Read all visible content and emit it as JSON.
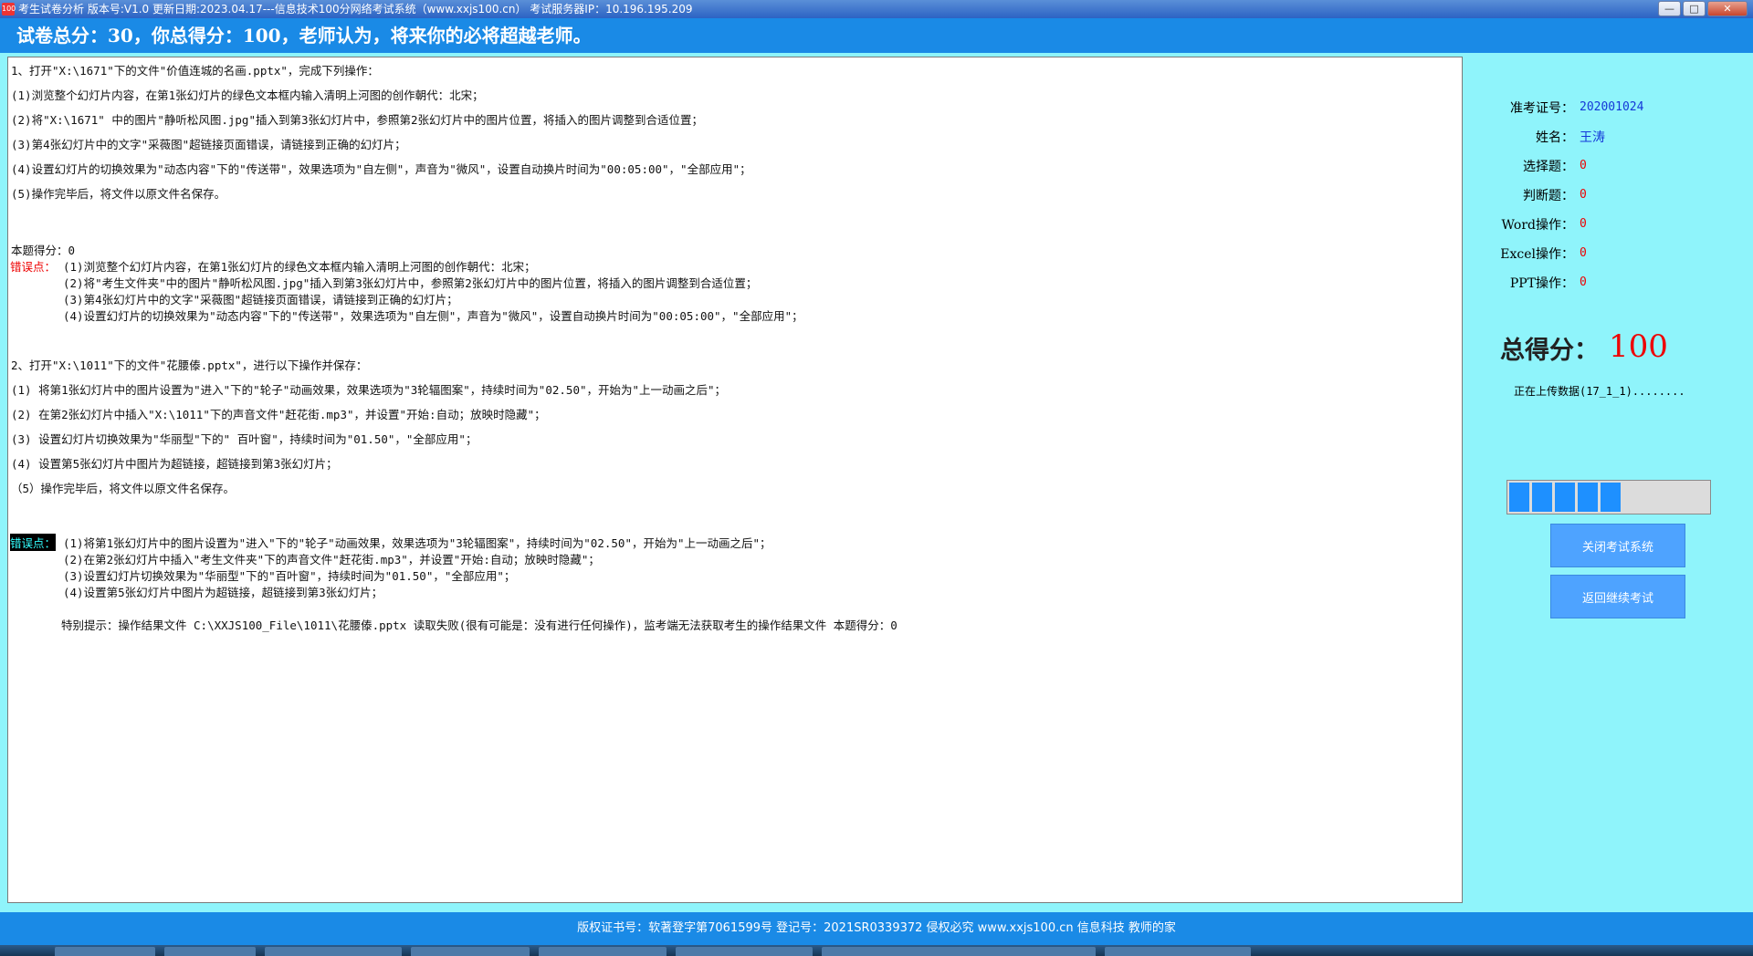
{
  "window": {
    "title": "考生试卷分析 版本号:V1.0 更新日期:2023.04.17---信息技术100分网络考试系统（www.xxjs100.cn）    考试服务器IP：10.196.195.209",
    "icon_text": "100",
    "minimize_label": "—",
    "maximize_label": "□",
    "close_label": "✕"
  },
  "banner": {
    "text": "试卷总分：30，你总得分：100，老师认为，将来你的必将超越老师。"
  },
  "question1": {
    "header": "1、打开\"X:\\1671\"下的文件\"价值连城的名画.pptx\"，完成下列操作：",
    "steps": [
      "(1)浏览整个幻灯片内容，在第1张幻灯片的绿色文本框内输入清明上河图的创作朝代：北宋；",
      "(2)将\"X:\\1671\" 中的图片\"静听松风图.jpg\"插入到第3张幻灯片中，参照第2张幻灯片中的图片位置，将插入的图片调整到合适位置；",
      "(3)第4张幻灯片中的文字\"采薇图\"超链接页面错误，请链接到正确的幻灯片；",
      "(4)设置幻灯片的切换效果为\"动态内容\"下的\"传送带\"，效果选项为\"自左侧\"，声音为\"微风\"，设置自动换片时间为\"00:05:00\"，\"全部应用\"；",
      "(5)操作完毕后，将文件以原文件名保存。"
    ],
    "score_text": "本题得分：0",
    "error_label": "错误点：",
    "errors": [
      "(1)浏览整个幻灯片内容，在第1张幻灯片的绿色文本框内输入清明上河图的创作朝代：北宋；",
      "(2)将\"考生文件夹\"中的图片\"静听松风图.jpg\"插入到第3张幻灯片中，参照第2张幻灯片中的图片位置，将插入的图片调整到合适位置；",
      "(3)第4张幻灯片中的文字\"采薇图\"超链接页面错误，请链接到正确的幻灯片；",
      "(4)设置幻灯片的切换效果为\"动态内容\"下的\"传送带\"，效果选项为\"自左侧\"，声音为\"微风\"，设置自动换片时间为\"00:05:00\"，\"全部应用\"；"
    ]
  },
  "question2": {
    "header": "2、打开\"X:\\1011\"下的文件\"花腰傣.pptx\"，进行以下操作并保存：",
    "steps": [
      "(1) 将第1张幻灯片中的图片设置为\"进入\"下的\"轮子\"动画效果，效果选项为\"3轮辐图案\"，持续时间为\"02.50\"，开始为\"上一动画之后\"；",
      "(2) 在第2张幻灯片中插入\"X:\\1011\"下的声音文件\"赶花街.mp3\"，并设置\"开始:自动；放映时隐藏\"；",
      "(3) 设置幻灯片切换效果为\"华丽型\"下的\" 百叶窗\"，持续时间为\"01.50\"，\"全部应用\"；",
      "(4) 设置第5张幻灯片中图片为超链接，超链接到第3张幻灯片；",
      "（5）操作完毕后，将文件以原文件名保存。"
    ],
    "error_label": "错误点：",
    "errors": [
      "(1)将第1张幻灯片中的图片设置为\"进入\"下的\"轮子\"动画效果，效果选项为\"3轮辐图案\"，持续时间为\"02.50\"，开始为\"上一动画之后\"；",
      "(2)在第2张幻灯片中插入\"考生文件夹\"下的声音文件\"赶花街.mp3\"，并设置\"开始:自动；放映时隐藏\"；",
      "(3)设置幻灯片切换效果为\"华丽型\"下的\"百叶窗\"，持续时间为\"01.50\"，\"全部应用\"；",
      "(4)设置第5张幻灯片中图片为超链接，超链接到第3张幻灯片；"
    ],
    "special_note": "特别提示：操作结果文件 C:\\XXJS100_File\\1011\\花腰傣.pptx 读取失败(很有可能是：没有进行任何操作)，监考端无法获取考生的操作结果文件        本题得分：0"
  },
  "student": {
    "exam_id_label": "准考证号：",
    "exam_id": "202001024",
    "name_label": "姓名：",
    "name": "王涛",
    "choice_label": "选择题：",
    "choice": "0",
    "judge_label": "判断题：",
    "judge": "0",
    "word_label": "Word操作：",
    "word": "0",
    "excel_label": "Excel操作：",
    "excel": "0",
    "ppt_label": "PPT操作：",
    "ppt": "0"
  },
  "total": {
    "label": "总得分：",
    "value": "100"
  },
  "upload_status": "正在上传数据(17_1_1)........",
  "progress": {
    "filled_segments": 5,
    "total_segments": 9,
    "color": "#1e90ff"
  },
  "buttons": {
    "close_exam": "关闭考试系统",
    "return_exam": "返回继续考试"
  },
  "footer": {
    "text": "版权证书号：软著登字第7061599号  登记号：2021SR0339372  侵权必究  www.xxjs100.cn  信息科技 教师的家"
  },
  "colors": {
    "background": "#8ff4fb",
    "banner": "#1a8ae6",
    "error_label": "#e00000",
    "value_blue": "#1438d8"
  }
}
